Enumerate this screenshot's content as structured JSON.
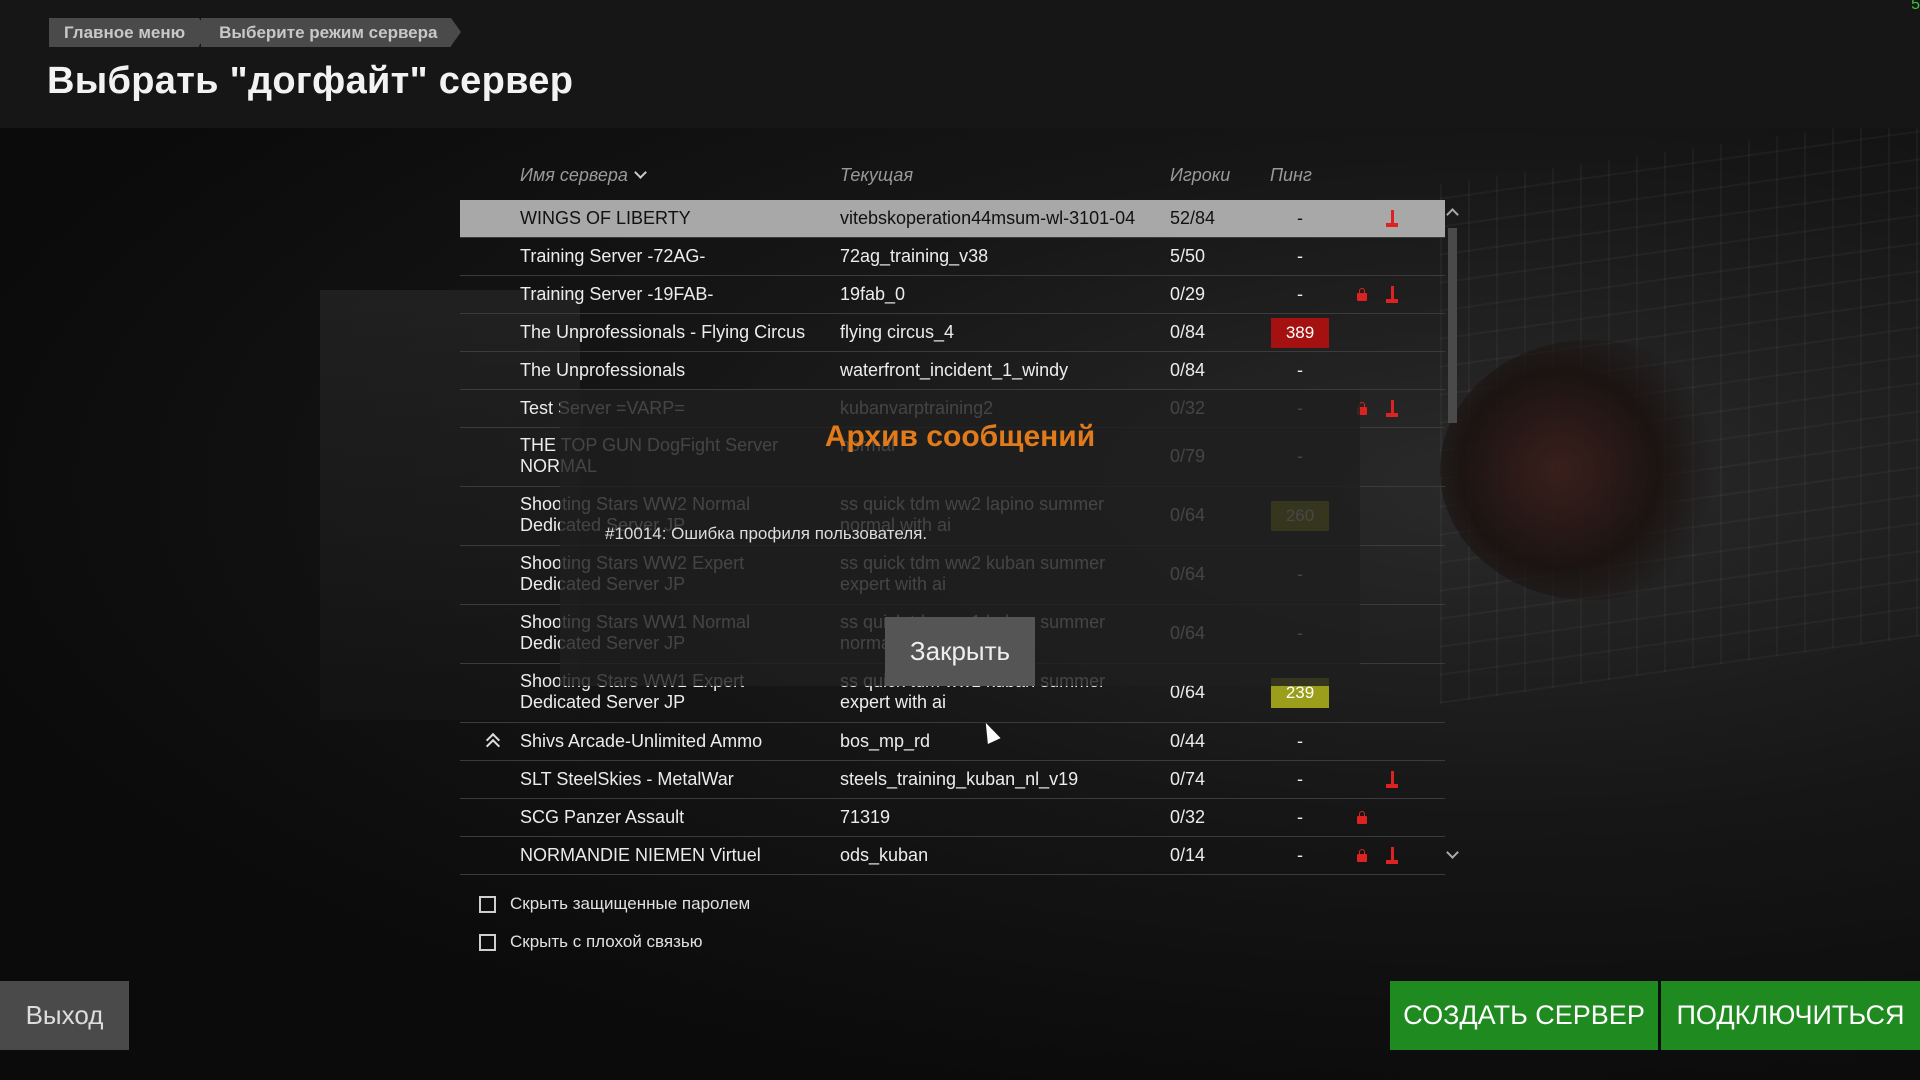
{
  "breadcrumb": [
    "Главное меню",
    "Выберите режим сервера"
  ],
  "page_title": "Выбрать \"догфайт\" сервер",
  "corner_text": "5",
  "columns": {
    "name": "Имя сервера",
    "map": "Текущая",
    "players": "Игроки",
    "ping": "Пинг"
  },
  "rows": [
    {
      "name": "WINGS OF LIBERTY",
      "map": "vitebskoperation44msum-wl-3101-04",
      "players": "52/84",
      "ping": "-",
      "selected": true,
      "lock": false,
      "stick": true
    },
    {
      "name": "Training Server -72AG-",
      "map": "72ag_training_v38",
      "players": "5/50",
      "ping": "-",
      "lock": false,
      "stick": false
    },
    {
      "name": "Training Server -19FAB-",
      "map": "19fab_0",
      "players": "0/29",
      "ping": "-",
      "lock": true,
      "stick": true
    },
    {
      "name": "The Unprofessionals - Flying Circus",
      "map": "flying circus_4",
      "players": "0/84",
      "ping": "389",
      "ping_color": "red",
      "lock": false,
      "stick": false
    },
    {
      "name": "The Unprofessionals",
      "map": "waterfront_incident_1_windy",
      "players": "0/84",
      "ping": "-",
      "lock": false,
      "stick": false
    },
    {
      "name": "Test Server =VARP=",
      "map": "kubanvarptraining2",
      "players": "0/32",
      "ping": "-",
      "lock": true,
      "stick": true
    },
    {
      "name": "THE TOP GUN DogFight Server NORMAL",
      "map": "normal",
      "players": "0/79",
      "ping": "-",
      "tall": true
    },
    {
      "name": "Shooting Stars WW2 Normal Dedicated Server JP",
      "map": "ss quick tdm ww2 lapino summer normal with ai",
      "players": "0/64",
      "ping": "260",
      "ping_color": "yellow",
      "tall": true
    },
    {
      "name": "Shooting Stars WW2 Expert Dedicated Server JP",
      "map": "ss quick tdm ww2 kuban summer expert with ai",
      "players": "0/64",
      "ping": "-",
      "tall": true
    },
    {
      "name": "Shooting Stars WW1 Normal Dedicated Server JP",
      "map": "ss quick tdm ww1 kuban summer normal with ai",
      "players": "0/64",
      "ping": "-",
      "tall": true
    },
    {
      "name": "Shooting Stars WW1 Expert Dedicated Server JP",
      "map": "ss quick tdm ww1 kuban summer expert with ai",
      "players": "0/64",
      "ping": "239",
      "ping_color": "yellow",
      "tall": true
    },
    {
      "name": "Shivs Arcade-Unlimited Ammo",
      "map": "bos_mp_rd",
      "players": "0/44",
      "ping": "-",
      "fav": true
    },
    {
      "name": "SLT SteelSkies - MetalWar",
      "map": "steels_training_kuban_nl_v19",
      "players": "0/74",
      "ping": "-",
      "stick": true
    },
    {
      "name": "SCG Panzer Assault",
      "map": "71319",
      "players": "0/32",
      "ping": "-",
      "lock": true
    },
    {
      "name": "NORMANDIE NIEMEN Virtuel",
      "map": "ods_kuban",
      "players": "0/14",
      "ping": "-",
      "lock": true,
      "stick": true
    }
  ],
  "modal": {
    "title": "Архив сообщений",
    "message": "#10014: Ошибка профиля пользователя.",
    "close_label": "Закрыть"
  },
  "filters": {
    "hide_password": "Скрыть защищенные паролем",
    "hide_bad_connection": "Скрыть с плохой связью"
  },
  "buttons": {
    "exit": "Выход",
    "create_server": "СОЗДАТЬ СЕРВЕР",
    "connect": "ПОДКЛЮЧИТЬСЯ"
  },
  "colors": {
    "accent_green": "#1f8a1f",
    "modal_title": "#e07a1a",
    "ping_red": "#a51010",
    "ping_yellow": "#9a9e1a",
    "warning_red": "#dd2222"
  }
}
